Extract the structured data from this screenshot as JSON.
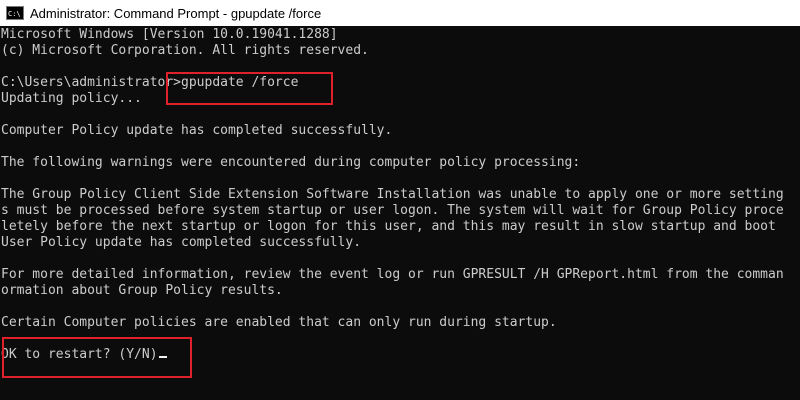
{
  "window": {
    "title": "Administrator: Command Prompt - gpupdate  /force",
    "icon": "cmd-icon",
    "icon_label": "C:\\"
  },
  "console": {
    "lines": [
      "Microsoft Windows [Version 10.0.19041.1288]",
      "(c) Microsoft Corporation. All rights reserved.",
      "",
      "C:\\Users\\administrator>gpupdate /force",
      "Updating policy...",
      "",
      "Computer Policy update has completed successfully.",
      "",
      "The following warnings were encountered during computer policy processing:",
      "",
      "The Group Policy Client Side Extension Software Installation was unable to apply one or more setting",
      "s must be processed before system startup or user logon. The system will wait for Group Policy proce",
      "letely before the next startup or logon for this user, and this may result in slow startup and boot",
      "User Policy update has completed successfully.",
      "",
      "For more detailed information, review the event log or run GPRESULT /H GPReport.html from the comman",
      "ormation about Group Policy results.",
      "",
      "Certain Computer policies are enabled that can only run during startup.",
      "",
      "OK to restart? (Y/N)"
    ]
  },
  "colors": {
    "background": "#0c0c0c",
    "text": "#cccccc",
    "titlebar": "#ffffff",
    "highlight": "#e0202a"
  }
}
